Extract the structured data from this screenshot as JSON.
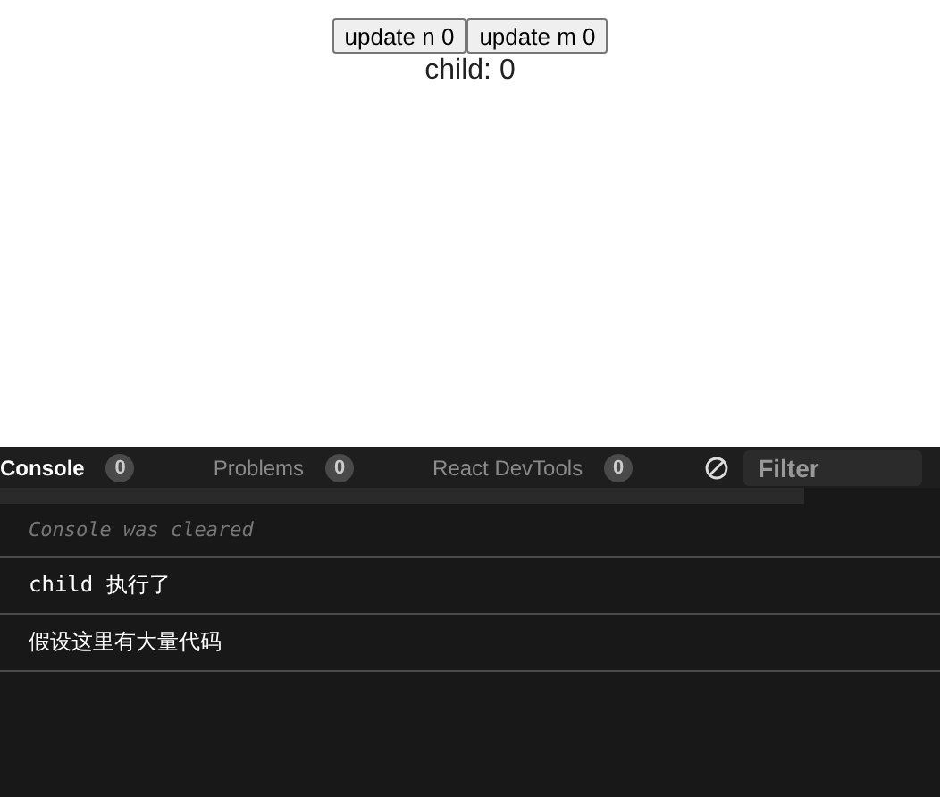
{
  "buttons": [
    {
      "label": "update n 0"
    },
    {
      "label": "update m 0"
    }
  ],
  "child_text": "child: 0",
  "devtools": {
    "tabs": [
      {
        "label": "Console",
        "count": "0",
        "selected": true
      },
      {
        "label": "Problems",
        "count": "0",
        "selected": false
      },
      {
        "label": "React DevTools",
        "count": "0",
        "selected": false
      }
    ],
    "filter": {
      "placeholder": "Filter"
    },
    "console_lines": [
      {
        "kind": "info",
        "text": "Console was cleared"
      },
      {
        "kind": "log",
        "text": "child 执行了"
      },
      {
        "kind": "log",
        "text": "假设这里有大量代码"
      }
    ]
  }
}
